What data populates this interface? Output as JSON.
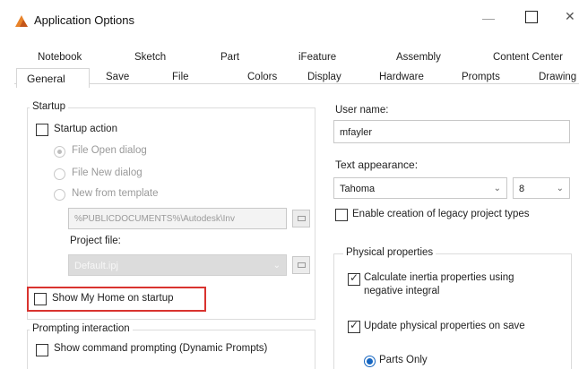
{
  "window": {
    "title": "Application Options"
  },
  "tabs": {
    "row1": [
      "Notebook",
      "Sketch",
      "Part",
      "iFeature",
      "Assembly",
      "Content Center"
    ],
    "row2": [
      "General",
      "Save",
      "File",
      "Colors",
      "Display",
      "Hardware",
      "Prompts",
      "Drawing"
    ]
  },
  "startup": {
    "group": "Startup",
    "startup_action": "Startup action",
    "file_open": "File Open dialog",
    "file_new": "File New dialog",
    "new_template": "New from template",
    "template_path": "%PUBLICDOCUMENTS%\\Autodesk\\Inv",
    "project_file_label": "Project file:",
    "project_file_value": "Default.ipj",
    "show_my_home": "Show My Home on startup"
  },
  "prompting": {
    "group": "Prompting interaction",
    "show_command": "Show command prompting (Dynamic Prompts)"
  },
  "user": {
    "label": "User name:",
    "value": "mfayler"
  },
  "text_appearance": {
    "label": "Text appearance:",
    "font": "Tahoma",
    "size": "8"
  },
  "legacy": "Enable creation of legacy project types",
  "physical": {
    "group": "Physical properties",
    "calc_inertia_l1": "Calculate inertia properties using",
    "calc_inertia_l2": "negative integral",
    "update_on_save": "Update physical properties on save",
    "parts_only": "Parts Only"
  },
  "colors": {
    "accent": "#1565c0",
    "highlight": "#d9332f"
  }
}
